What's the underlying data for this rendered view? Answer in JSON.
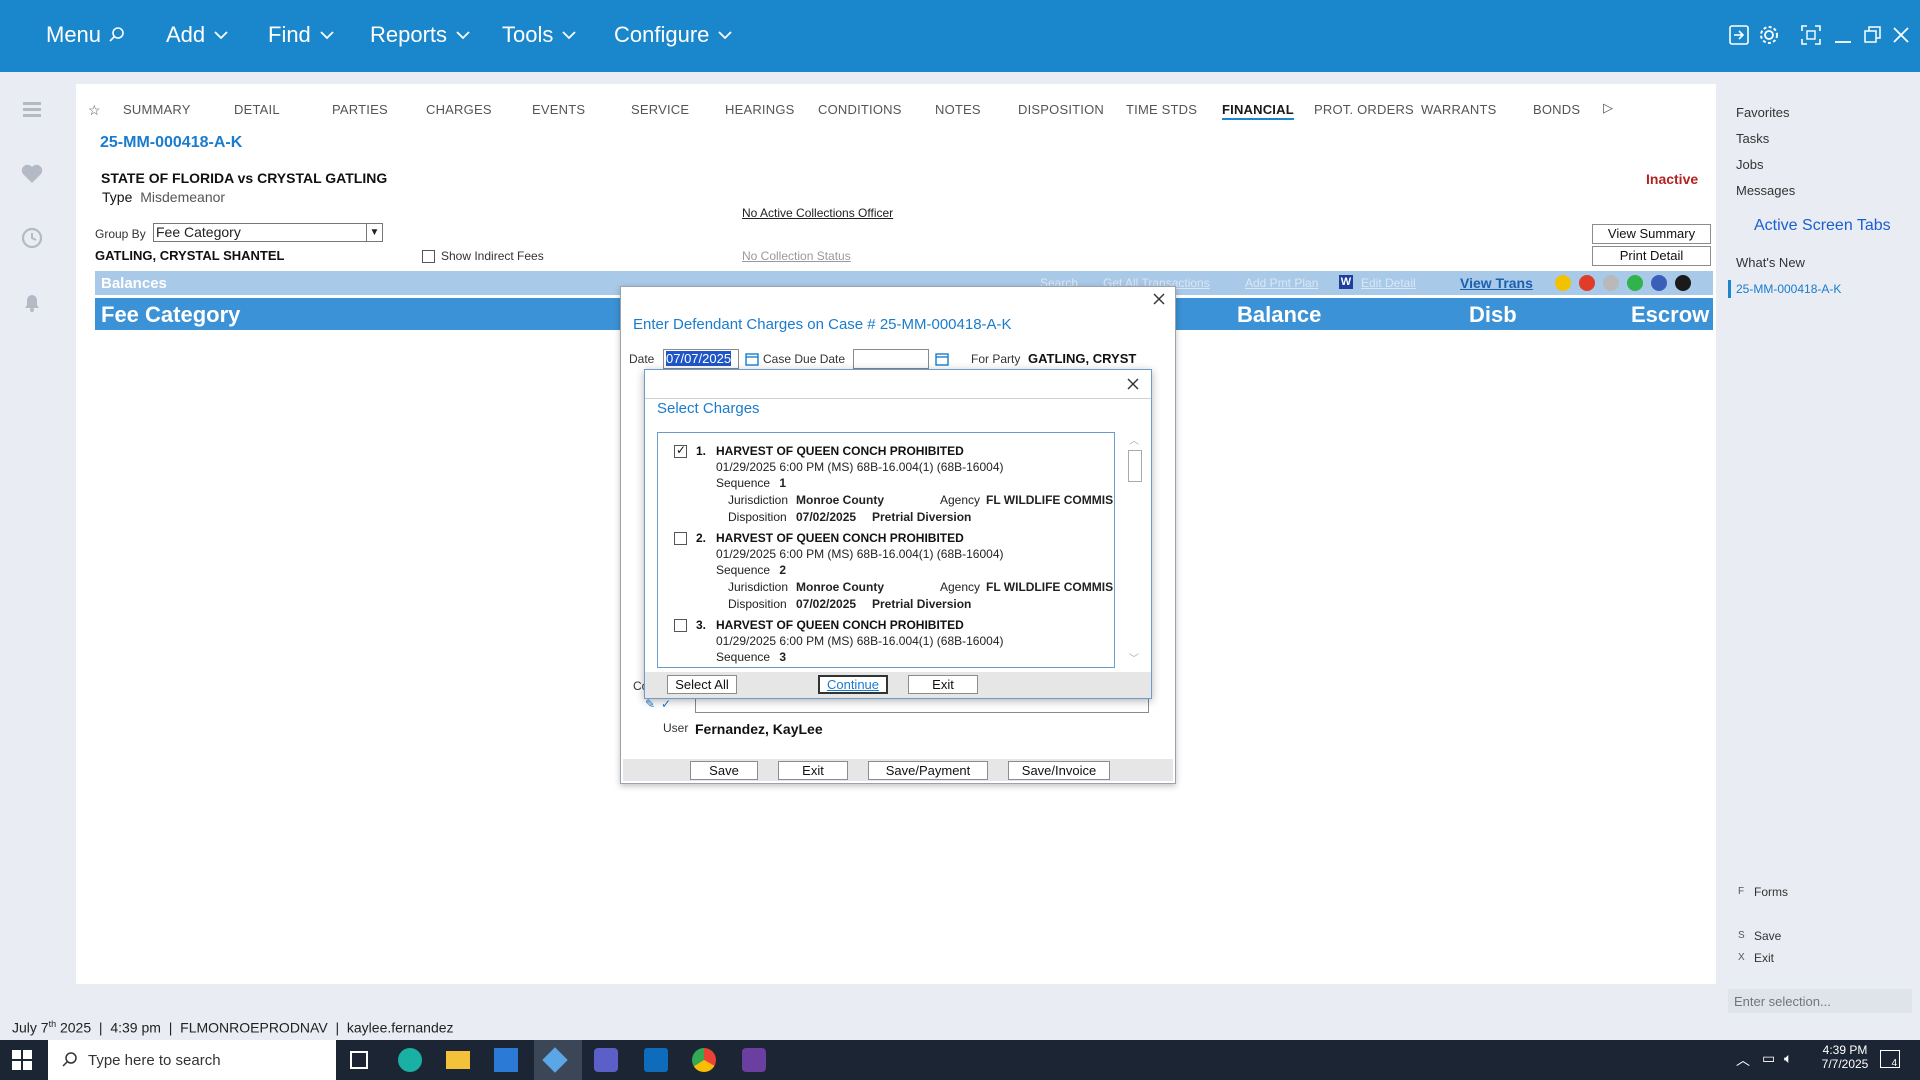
{
  "nav": {
    "menu": "Menu",
    "add": "Add",
    "find": "Find",
    "reports": "Reports",
    "tools": "Tools",
    "configure": "Configure"
  },
  "tabs": [
    "SUMMARY",
    "DETAIL",
    "PARTIES",
    "CHARGES",
    "EVENTS",
    "SERVICE",
    "HEARINGS",
    "CONDITIONS",
    "NOTES",
    "DISPOSITION",
    "TIME STDS",
    "FINANCIAL",
    "PROT. ORDERS",
    "WARRANTS",
    "BONDS"
  ],
  "active_tab": "FINANCIAL",
  "case": {
    "number": "25-MM-000418-A-K",
    "style": "STATE OF FLORIDA vs CRYSTAL GATLING",
    "type_label": "Type",
    "type_value": "Misdemeanor",
    "status": "Inactive",
    "collections_officer": "No Active Collections Officer",
    "collection_status": "No Collection Status",
    "group_by_label": "Group By",
    "group_by_value": "Fee Category",
    "defendant": "GATLING, CRYSTAL SHANTEL",
    "show_indirect_fees": "Show Indirect Fees",
    "view_summary": "View Summary",
    "print_detail": "Print Detail"
  },
  "balances": {
    "title": "Balances",
    "search": "Search",
    "get_all": "Get All Transactions",
    "add_pmt_plan": "Add Pmt Plan",
    "edit_detail": "Edit Detail",
    "view_trans": "View Trans",
    "columns": {
      "fee_category": "Fee Category",
      "balance": "Balance",
      "disb": "Disb",
      "escrow": "Escrow"
    }
  },
  "right_panel": {
    "favorites": "Favorites",
    "tasks": "Tasks",
    "jobs": "Jobs",
    "messages": "Messages",
    "active_screen_tabs": "Active Screen Tabs",
    "whats_new": "What's New",
    "active_case": "25-MM-000418-A-K",
    "forms_key": "F",
    "forms": "Forms",
    "save_key": "S",
    "save": "Save",
    "exit_key": "X",
    "exit": "Exit",
    "selection_placeholder": "Enter selection..."
  },
  "charges_dialog": {
    "title": "Enter Defendant Charges on Case # 25-MM-000418-A-K",
    "date_label": "Date",
    "date_value": "07/07/2025",
    "due_label": "Case Due Date",
    "party_label": "For Party",
    "party_value": "GATLING, CRYST",
    "comment_label_partial": "Co",
    "user_label": "User",
    "user_value": "Fernandez, KayLee",
    "save": "Save",
    "exit": "Exit",
    "save_payment": "Save/Payment",
    "save_invoice": "Save/Invoice"
  },
  "select_dialog": {
    "title": "Select Charges",
    "select_all": "Select All",
    "continue": "Continue",
    "exit": "Exit",
    "charges": [
      {
        "num": "1.",
        "name": "HARVEST OF QUEEN CONCH PROHIBITED",
        "line": "01/29/2025 6:00 PM (MS) 68B-16.004(1) (68B-16004)",
        "seq_label": "Sequence",
        "seq": "1",
        "juris_label": "Jurisdiction",
        "juris": "Monroe County",
        "agency_label": "Agency",
        "agency": "FL WILDLIFE COMMIS",
        "disp_label": "Disposition",
        "disp_date": "07/02/2025",
        "disp": "Pretrial Diversion",
        "checked": true
      },
      {
        "num": "2.",
        "name": "HARVEST OF QUEEN CONCH PROHIBITED",
        "line": "01/29/2025 6:00 PM (MS) 68B-16.004(1) (68B-16004)",
        "seq_label": "Sequence",
        "seq": "2",
        "juris_label": "Jurisdiction",
        "juris": "Monroe County",
        "agency_label": "Agency",
        "agency": "FL WILDLIFE COMMIS",
        "disp_label": "Disposition",
        "disp_date": "07/02/2025",
        "disp": "Pretrial Diversion",
        "checked": false
      },
      {
        "num": "3.",
        "name": "HARVEST OF QUEEN CONCH PROHIBITED",
        "line": "01/29/2025 6:00 PM (MS) 68B-16.004(1) (68B-16004)",
        "seq_label": "Sequence",
        "seq": "3",
        "checked": false
      }
    ]
  },
  "status_bar": {
    "date_prefix": "July 7",
    "date_sup": "th",
    "date_suffix": "2025",
    "time": "4:39 pm",
    "server": "FLMONROEPRODNAV",
    "user": "kaylee.fernandez"
  },
  "taskbar": {
    "search_placeholder": "Type here to search",
    "time": "4:39 PM",
    "date": "7/7/2025",
    "notifications": "4"
  },
  "colors": {
    "brand_blue": "#1a86cb",
    "header_blue": "#3c92d6",
    "link_blue": "#1a7ccd",
    "inactive_red": "#b22222"
  }
}
